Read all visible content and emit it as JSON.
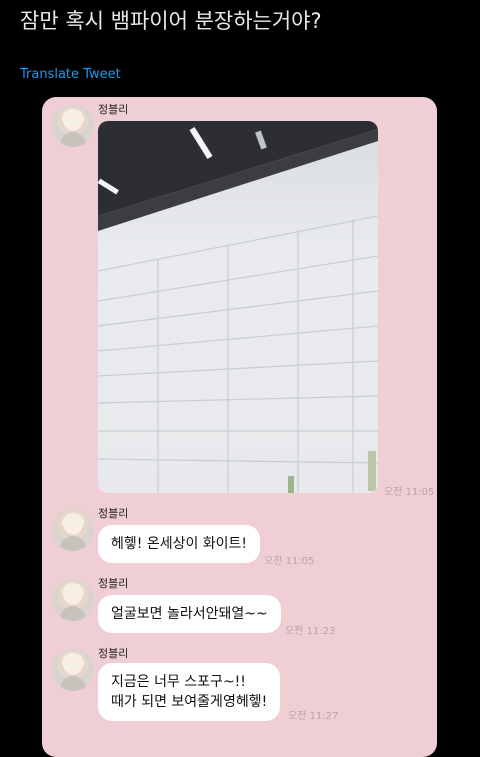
{
  "tweet": {
    "text": "잠만 혹시 뱀파이어 분장하는거야?",
    "translate_label": "Translate Tweet"
  },
  "chat": {
    "photo_time": "오전 11:05",
    "messages": [
      {
        "sender": "정블리",
        "text": "헤헿! 온세상이 화이트!",
        "time": "오전 11:05"
      },
      {
        "sender": "정블리",
        "text": "얼굴보면 놀라서안돼열~~",
        "time": "오전 11:23"
      },
      {
        "sender": "정블리",
        "text": "지금은 너무 스포구~!!\n때가 되면 보여줄게영헤헿!",
        "time": "오전 11:27"
      }
    ],
    "photo_sender": "정블리"
  },
  "colors": {
    "background": "#000000",
    "card": "#f0cfd4",
    "link": "#1d9bf0",
    "bubble": "#ffffff"
  }
}
